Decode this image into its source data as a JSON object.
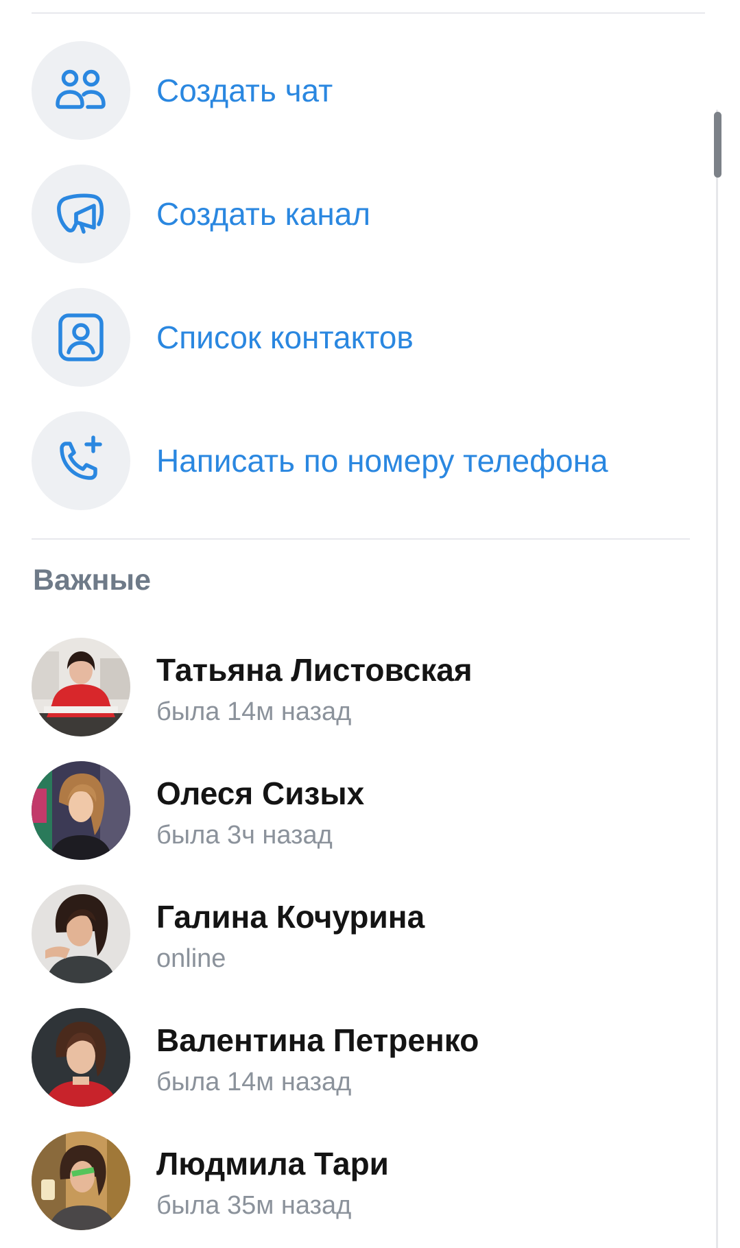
{
  "actions": [
    {
      "label": "Создать чат",
      "icon": "people-icon"
    },
    {
      "label": "Создать канал",
      "icon": "megaphone-icon"
    },
    {
      "label": "Список контактов",
      "icon": "contact-card-icon"
    },
    {
      "label": "Написать по номеру телефона",
      "icon": "phone-add-icon"
    }
  ],
  "section": {
    "title": "Важные"
  },
  "contacts": [
    {
      "name": "Татьяна Листовская",
      "status": "была 14м назад"
    },
    {
      "name": "Олеся Сизых",
      "status": "была 3ч назад"
    },
    {
      "name": "Галина Кочурина",
      "status": "online"
    },
    {
      "name": "Валентина Петренко",
      "status": "была 14м назад"
    },
    {
      "name": "Людмила Тари",
      "status": "была 35м назад"
    }
  ],
  "colors": {
    "accent": "#2a87e0",
    "icon_bg": "#eef0f3",
    "section_title": "#6e7a88",
    "status_text": "#8b929b"
  }
}
